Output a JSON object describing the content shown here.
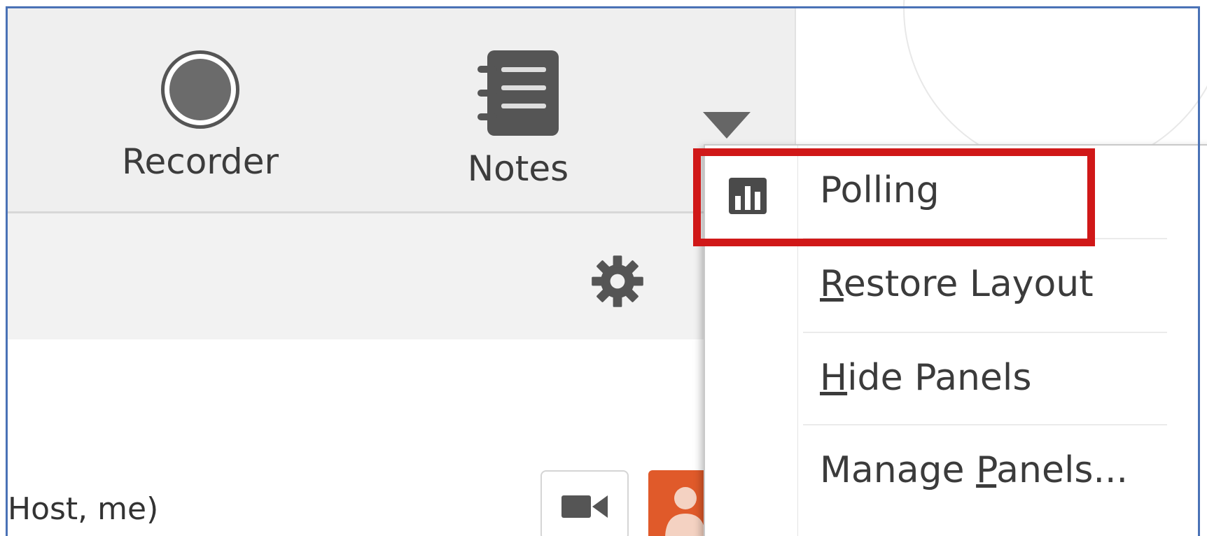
{
  "toolbar": {
    "recorder_label": "Recorder",
    "notes_label": "Notes"
  },
  "menu": {
    "items": [
      {
        "label": "Polling",
        "icon": "polling-icon",
        "highlighted": true
      },
      {
        "label": "Restore Layout",
        "mnemonic": "R"
      },
      {
        "label": "Hide Panels",
        "mnemonic": "H"
      },
      {
        "label": "Manage Panels...",
        "mnemonic": "P"
      }
    ]
  },
  "participant": {
    "label": "Host, me)"
  },
  "colors": {
    "frame_border": "#4a72b6",
    "highlight": "#d01818",
    "person_button": "#e05a2a"
  },
  "icons": {
    "recorder": "recorder-icon",
    "notes": "notes-icon",
    "dropdown": "dropdown-arrow-icon",
    "settings": "gear-icon",
    "camera": "video-camera-icon",
    "person": "person-icon"
  }
}
